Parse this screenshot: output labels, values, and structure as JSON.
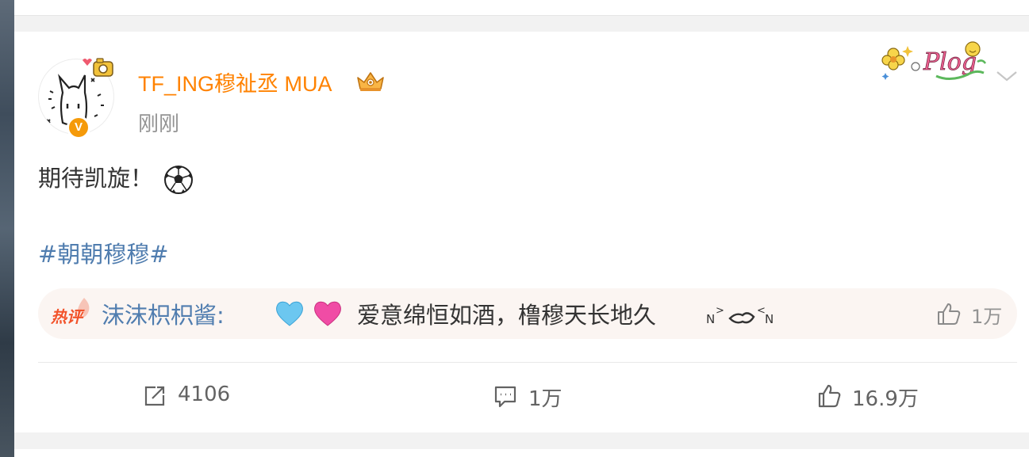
{
  "post": {
    "username": "TF_ING穆祉丞 MUA",
    "time": "刚刚",
    "verified_badge": "V",
    "text": "期待凯旋！",
    "hashtag": "#朝朝穆穆#",
    "sticker_text": "Plog"
  },
  "hot_comment": {
    "tag": "热评",
    "author": "沫沫枳枳酱:",
    "text": "爱意绵恒如酒，橹穆天长地久",
    "like_count": "1万"
  },
  "actions": {
    "repost_count": "4106",
    "comment_count": "1万",
    "like_count": "16.9万"
  },
  "colors": {
    "username": "#ff8200",
    "link": "#507daf",
    "hot_tag": "#f2532b",
    "muted": "#939393"
  }
}
